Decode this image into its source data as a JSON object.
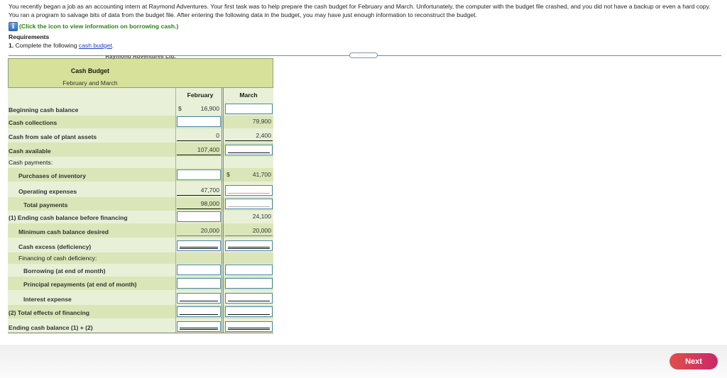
{
  "intro": {
    "line1": "You recently began a job as an accounting intern at Raymond Adventures. Your first task was to help prepare the cash budget for February and March. Unfortunately, the computer with the budget file crashed, and you did not have a backup or even a hard copy. You ran a program to salvage bits of data from the budget file. After entering the following data in the budget, you may have just enough information to reconstruct the budget.",
    "info_link": "(Click the icon to view information on borrowing cash.)",
    "info_icon": "i"
  },
  "requirements": {
    "title": "Requirements",
    "item_number": "1.",
    "item_text": "Complete the following",
    "item_link": "cash budget",
    "item_end": "."
  },
  "expander_label": "·····",
  "budget": {
    "company": "Raymond Adventures Ltd.",
    "title": "Cash Budget",
    "subtitle": "February and March",
    "columns": [
      "February",
      "March"
    ],
    "currency_symbol": "$",
    "rows": [
      {
        "label": "Beginning cash balance",
        "feb": "16,900",
        "mar": ""
      },
      {
        "label": "Cash collections",
        "feb": "",
        "mar": "79,900"
      },
      {
        "label": "Cash from sale of plant assets",
        "feb": "0",
        "mar": "2,400"
      },
      {
        "label": "Cash available",
        "feb": "107,400",
        "mar": ""
      },
      {
        "label": "Cash payments:",
        "feb": null,
        "mar": null
      },
      {
        "label": "Purchases of inventory",
        "feb": "",
        "mar": "41,700"
      },
      {
        "label": "Operating expenses",
        "feb": "47,700",
        "mar": ""
      },
      {
        "label": "Total payments",
        "feb": "98,000",
        "mar": ""
      },
      {
        "label": "(1) Ending cash balance before financing",
        "feb": "",
        "mar": "24,100"
      },
      {
        "label": "Minimum cash balance desired",
        "feb": "20,000",
        "mar": "20,000"
      },
      {
        "label": "Cash excess (deficiency)",
        "feb": "",
        "mar": ""
      },
      {
        "label": "Financing of cash deficiency:",
        "feb": null,
        "mar": null
      },
      {
        "label": "Borrowing (at end of month)",
        "feb": "",
        "mar": ""
      },
      {
        "label": "Principal repayments (at end of month)",
        "feb": "",
        "mar": ""
      },
      {
        "label": "Interest expense",
        "feb": "",
        "mar": ""
      },
      {
        "label": "(2) Total effects of financing",
        "feb": "",
        "mar": ""
      },
      {
        "label": "Ending cash balance (1) + (2)",
        "feb": "",
        "mar": ""
      }
    ]
  },
  "footer": {
    "next_label": "Next"
  }
}
